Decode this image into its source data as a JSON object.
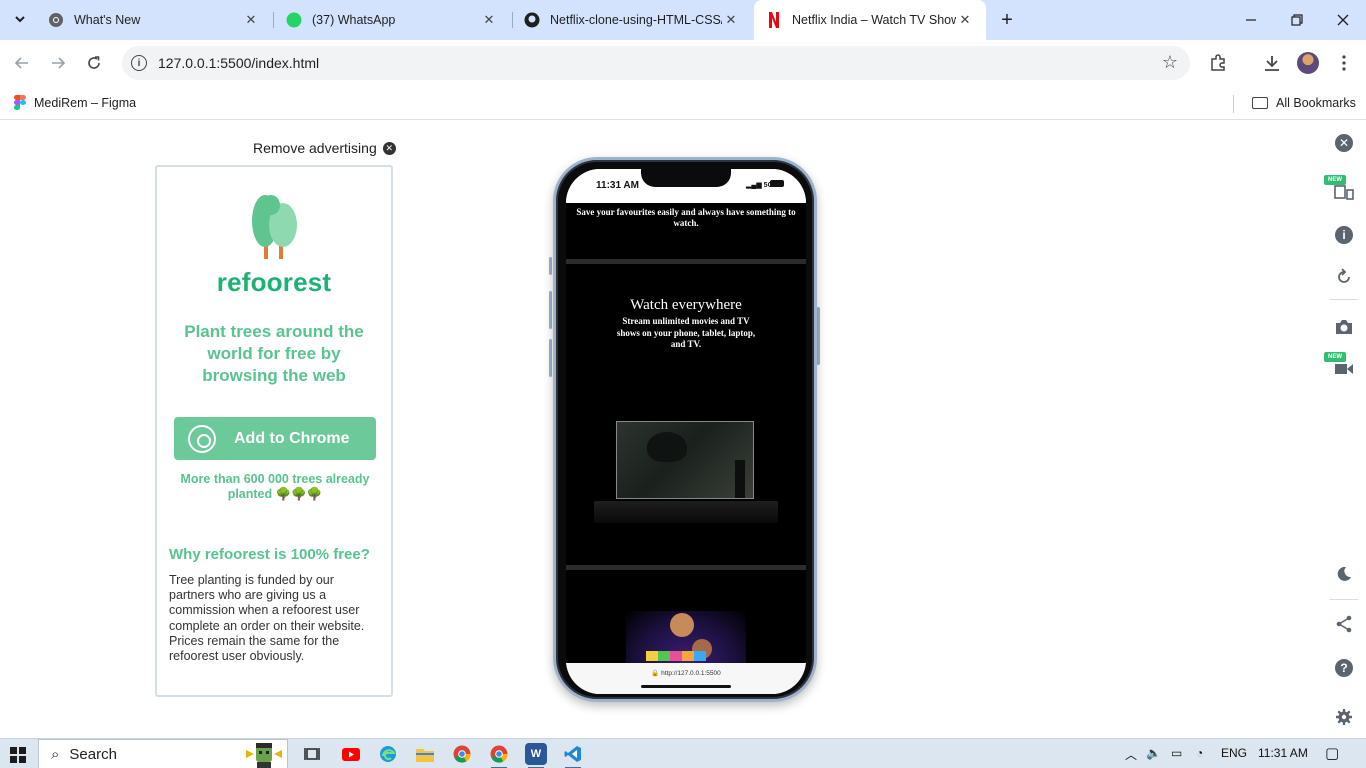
{
  "browser": {
    "tabs": [
      {
        "title": "What's New",
        "favicon": "chrome-icon",
        "active": false
      },
      {
        "title": "(37) WhatsApp",
        "favicon": "whatsapp-icon",
        "badge": "37",
        "active": false
      },
      {
        "title": "Netflix-clone-using-HTML-CSS/",
        "favicon": "github-icon",
        "active": false
      },
      {
        "title": "Netflix India – Watch TV Shows",
        "favicon": "netflix-icon",
        "active": true
      }
    ],
    "new_tab": "+",
    "address": "127.0.0.1:5500/index.html",
    "bookmarks": [
      {
        "label": "MediRem – Figma",
        "icon": "figma-icon"
      }
    ],
    "all_bookmarks": "All Bookmarks"
  },
  "ad": {
    "remove_label": "Remove advertising",
    "brand": "refoorest",
    "tagline": "Plant trees around the world for free by browsing the web",
    "button_label": "Add to Chrome",
    "planted": "More than 600 000 trees already planted 🌳🌳🌳",
    "why_title": "Why refoorest is 100% free?",
    "why_text": "Tree planting is funded by our partners who are giving us a commission when a refoorest user complete an order on their website. Prices remain the same for the refoorest user obviously."
  },
  "phone": {
    "time": "11:31 AM",
    "signal": "5G",
    "fav_text": "Save your favourites easily and always have something to watch.",
    "watch_title": "Watch everywhere",
    "watch_text": "Stream unlimited movies and TV shows on your phone, tablet, laptop, and TV.",
    "url": "http://127.0.0.1:5500"
  },
  "rail": {
    "new_badge": "NEW"
  },
  "taskbar": {
    "search": "Search",
    "language": "ENG",
    "time": "11:31 AM"
  },
  "colors": {
    "tabstrip": "#d3e3fd",
    "refoorest_green": "#1bb274",
    "button_green": "#6cc99a",
    "netflix_red": "#e50914"
  }
}
